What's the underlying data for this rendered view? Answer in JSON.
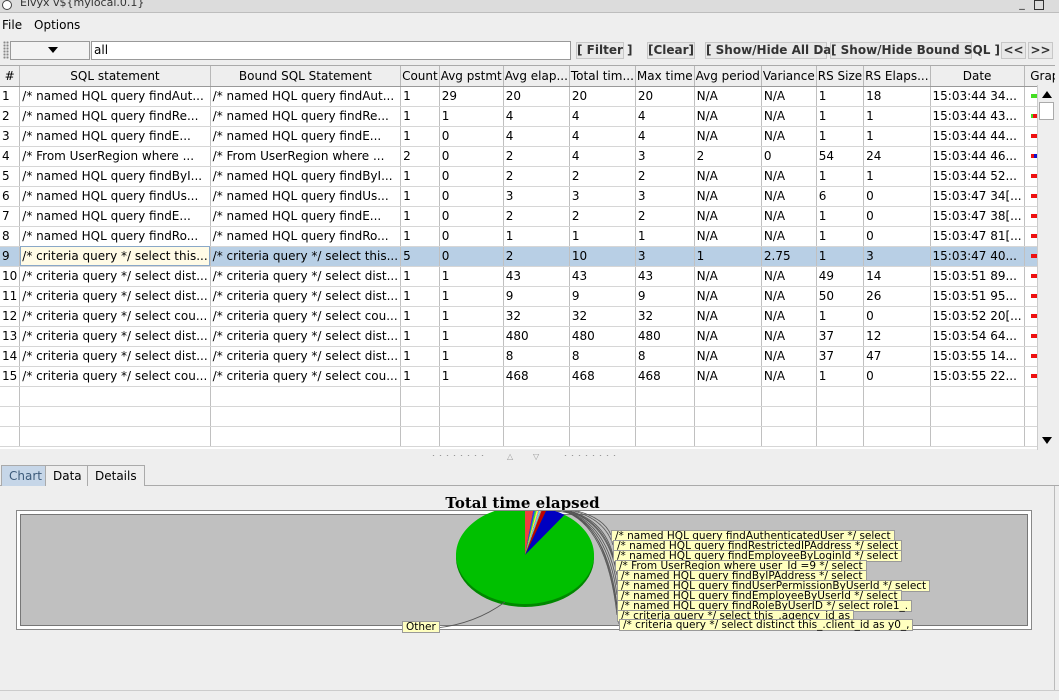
{
  "window": {
    "title": "Elvyx v${mylocal.0.1}"
  },
  "menu": {
    "file": "File",
    "options": "Options"
  },
  "toolbar": {
    "filter_value": "all",
    "filter_btn": "[ Filter ]",
    "clear_btn": "[Clear]",
    "show_all_btn": "[ Show/Hide All Data ]",
    "show_bound_btn": "[ Show/Hide Bound SQL ]",
    "prev_btn": "<<",
    "next_btn": ">>"
  },
  "table": {
    "columns": [
      "#",
      "SQL statement",
      "Bound SQL Statement",
      "Count",
      "Avg pstmt",
      "Avg elap...",
      "Total tim...",
      "Max time",
      "Avg period",
      "Variance",
      "RS Size",
      "RS Elaps...",
      "Date",
      "Graph"
    ],
    "rows": [
      {
        "cells": [
          "1",
          "/* named HQL query findAut...",
          "/* named HQL query findAut...",
          "1",
          "29",
          "20",
          "20",
          "20",
          "N/A",
          "N/A",
          "1",
          "18",
          "15:03:44 34..."
        ],
        "graph": [
          [
            "#44dd22",
            40
          ],
          [
            "#ee1111",
            30
          ],
          [
            "#1111cc",
            30
          ]
        ]
      },
      {
        "cells": [
          "2",
          "/* named HQL query findRe...",
          "/* named HQL query findRe...",
          "1",
          "1",
          "4",
          "4",
          "4",
          "N/A",
          "N/A",
          "1",
          "1",
          "15:03:44 43..."
        ],
        "graph": [
          [
            "#44dd22",
            5
          ],
          [
            "#ee1111",
            75
          ],
          [
            "#1111cc",
            20
          ]
        ]
      },
      {
        "cells": [
          "3",
          "/* named HQL query findE...",
          "/* named HQL query findE...",
          "1",
          "0",
          "4",
          "4",
          "4",
          "N/A",
          "N/A",
          "1",
          "1",
          "15:03:44 44..."
        ],
        "graph": [
          [
            "#ee1111",
            80
          ],
          [
            "#1111cc",
            20
          ]
        ]
      },
      {
        "cells": [
          "4",
          "/* From UserRegion where ...",
          "/* From UserRegion where ...",
          "2",
          "0",
          "2",
          "4",
          "3",
          "2",
          "0",
          "54",
          "24",
          "15:03:44 46..."
        ],
        "graph": [
          [
            "#ee1111",
            8
          ],
          [
            "#1111cc",
            92
          ]
        ]
      },
      {
        "cells": [
          "5",
          "/* named HQL query findByI...",
          "/* named HQL query findByI...",
          "1",
          "0",
          "2",
          "2",
          "2",
          "N/A",
          "N/A",
          "1",
          "1",
          "15:03:44 52..."
        ],
        "graph": [
          [
            "#ee1111",
            70
          ],
          [
            "#1111cc",
            30
          ]
        ]
      },
      {
        "cells": [
          "6",
          "/* named HQL query findUs...",
          "/* named HQL query findUs...",
          "1",
          "0",
          "3",
          "3",
          "3",
          "N/A",
          "N/A",
          "6",
          "0",
          "15:03:47 34[..."
        ],
        "graph": [
          [
            "#ee1111",
            100
          ]
        ]
      },
      {
        "cells": [
          "7",
          "/* named HQL query findE...",
          "/* named HQL query findE...",
          "1",
          "0",
          "2",
          "2",
          "2",
          "N/A",
          "N/A",
          "1",
          "0",
          "15:03:47 38[..."
        ],
        "graph": [
          [
            "#ee1111",
            100
          ]
        ]
      },
      {
        "cells": [
          "8",
          "/* named HQL query findRo...",
          "/* named HQL query findRo...",
          "1",
          "0",
          "1",
          "1",
          "1",
          "N/A",
          "N/A",
          "1",
          "0",
          "15:03:47 81[..."
        ],
        "graph": [
          [
            "#ee1111",
            100
          ]
        ]
      },
      {
        "cells": [
          "9",
          "/* criteria query */ select this...",
          "/* criteria query */ select this...",
          "5",
          "0",
          "2",
          "10",
          "3",
          "1",
          "2.75",
          "1",
          "3",
          "15:03:47 40..."
        ],
        "graph": [
          [
            "#ee1111",
            35
          ],
          [
            "#1111cc",
            65
          ]
        ]
      },
      {
        "cells": [
          "10",
          "/* criteria query */ select dist...",
          "/* criteria query */ select dist...",
          "1",
          "1",
          "43",
          "43",
          "43",
          "N/A",
          "N/A",
          "49",
          "14",
          "15:03:51 89..."
        ],
        "graph": [
          [
            "#ee1111",
            75
          ],
          [
            "#1111cc",
            25
          ]
        ]
      },
      {
        "cells": [
          "11",
          "/* criteria query */ select dist...",
          "/* criteria query */ select dist...",
          "1",
          "1",
          "9",
          "9",
          "9",
          "N/A",
          "N/A",
          "50",
          "26",
          "15:03:51 95..."
        ],
        "graph": [
          [
            "#ee1111",
            25
          ],
          [
            "#1111cc",
            75
          ]
        ]
      },
      {
        "cells": [
          "12",
          "/* criteria query */ select cou...",
          "/* criteria query */ select cou...",
          "1",
          "1",
          "32",
          "32",
          "32",
          "N/A",
          "N/A",
          "1",
          "0",
          "15:03:52 20[..."
        ],
        "graph": [
          [
            "#ee1111",
            100
          ]
        ]
      },
      {
        "cells": [
          "13",
          "/* criteria query */ select dist...",
          "/* criteria query */ select dist...",
          "1",
          "1",
          "480",
          "480",
          "480",
          "N/A",
          "N/A",
          "37",
          "12",
          "15:03:54 64..."
        ],
        "graph": [
          [
            "#ee1111",
            90
          ],
          [
            "#1111cc",
            10
          ]
        ]
      },
      {
        "cells": [
          "14",
          "/* criteria query */ select dist...",
          "/* criteria query */ select dist...",
          "1",
          "1",
          "8",
          "8",
          "8",
          "N/A",
          "N/A",
          "37",
          "47",
          "15:03:55 14..."
        ],
        "graph": [
          [
            "#ee1111",
            15
          ],
          [
            "#1111cc",
            85
          ]
        ]
      },
      {
        "cells": [
          "15",
          "/* criteria query */ select cou...",
          "/* criteria query */ select cou...",
          "1",
          "1",
          "468",
          "468",
          "468",
          "N/A",
          "N/A",
          "1",
          "0",
          "15:03:55 22..."
        ],
        "graph": [
          [
            "#ee1111",
            100
          ]
        ]
      }
    ],
    "selected_row": 8
  },
  "tabs": [
    "Chart",
    "Data",
    "Details"
  ],
  "chart": {
    "title": "Total time elapsed"
  },
  "chart_data": {
    "type": "pie",
    "title": "Total time elapsed",
    "slices": [
      {
        "label": "Other",
        "value": 86.5,
        "color": "#00c000"
      },
      {
        "label": "/* named HQL query findAuthenticatedUser */ select",
        "value": 2.0,
        "color": "#ee4040"
      },
      {
        "label": "/* named HQL query findRestrictedIPAddress */ select",
        "value": 0.4,
        "color": "#3030ff"
      },
      {
        "label": "/* named HQL query findEmployeeByLoginId */ select",
        "value": 0.4,
        "color": "#40e040"
      },
      {
        "label": "/* From UserRegion where user_Id =9 */ select",
        "value": 0.4,
        "color": "#ffff40"
      },
      {
        "label": "/* named HQL query findByIPAddress */ select",
        "value": 0.2,
        "color": "#ff40ff"
      },
      {
        "label": "/* named HQL query findUserPermissionByUserId */ select",
        "value": 0.3,
        "color": "#40ffff"
      },
      {
        "label": "/* named HQL query findEmployeeByUserId */ select",
        "value": 0.2,
        "color": "#ff8080"
      },
      {
        "label": "/* named HQL query findRoleByUserID */ select role1_.",
        "value": 0.1,
        "color": "#808080"
      },
      {
        "label": "/* criteria query */ select this_.agency_id as",
        "value": 1.0,
        "color": "#c00000"
      },
      {
        "label": "/* criteria query */ select distinct this_.client_id as y0_,",
        "value": 4.3,
        "color": "#0000c0"
      }
    ]
  }
}
